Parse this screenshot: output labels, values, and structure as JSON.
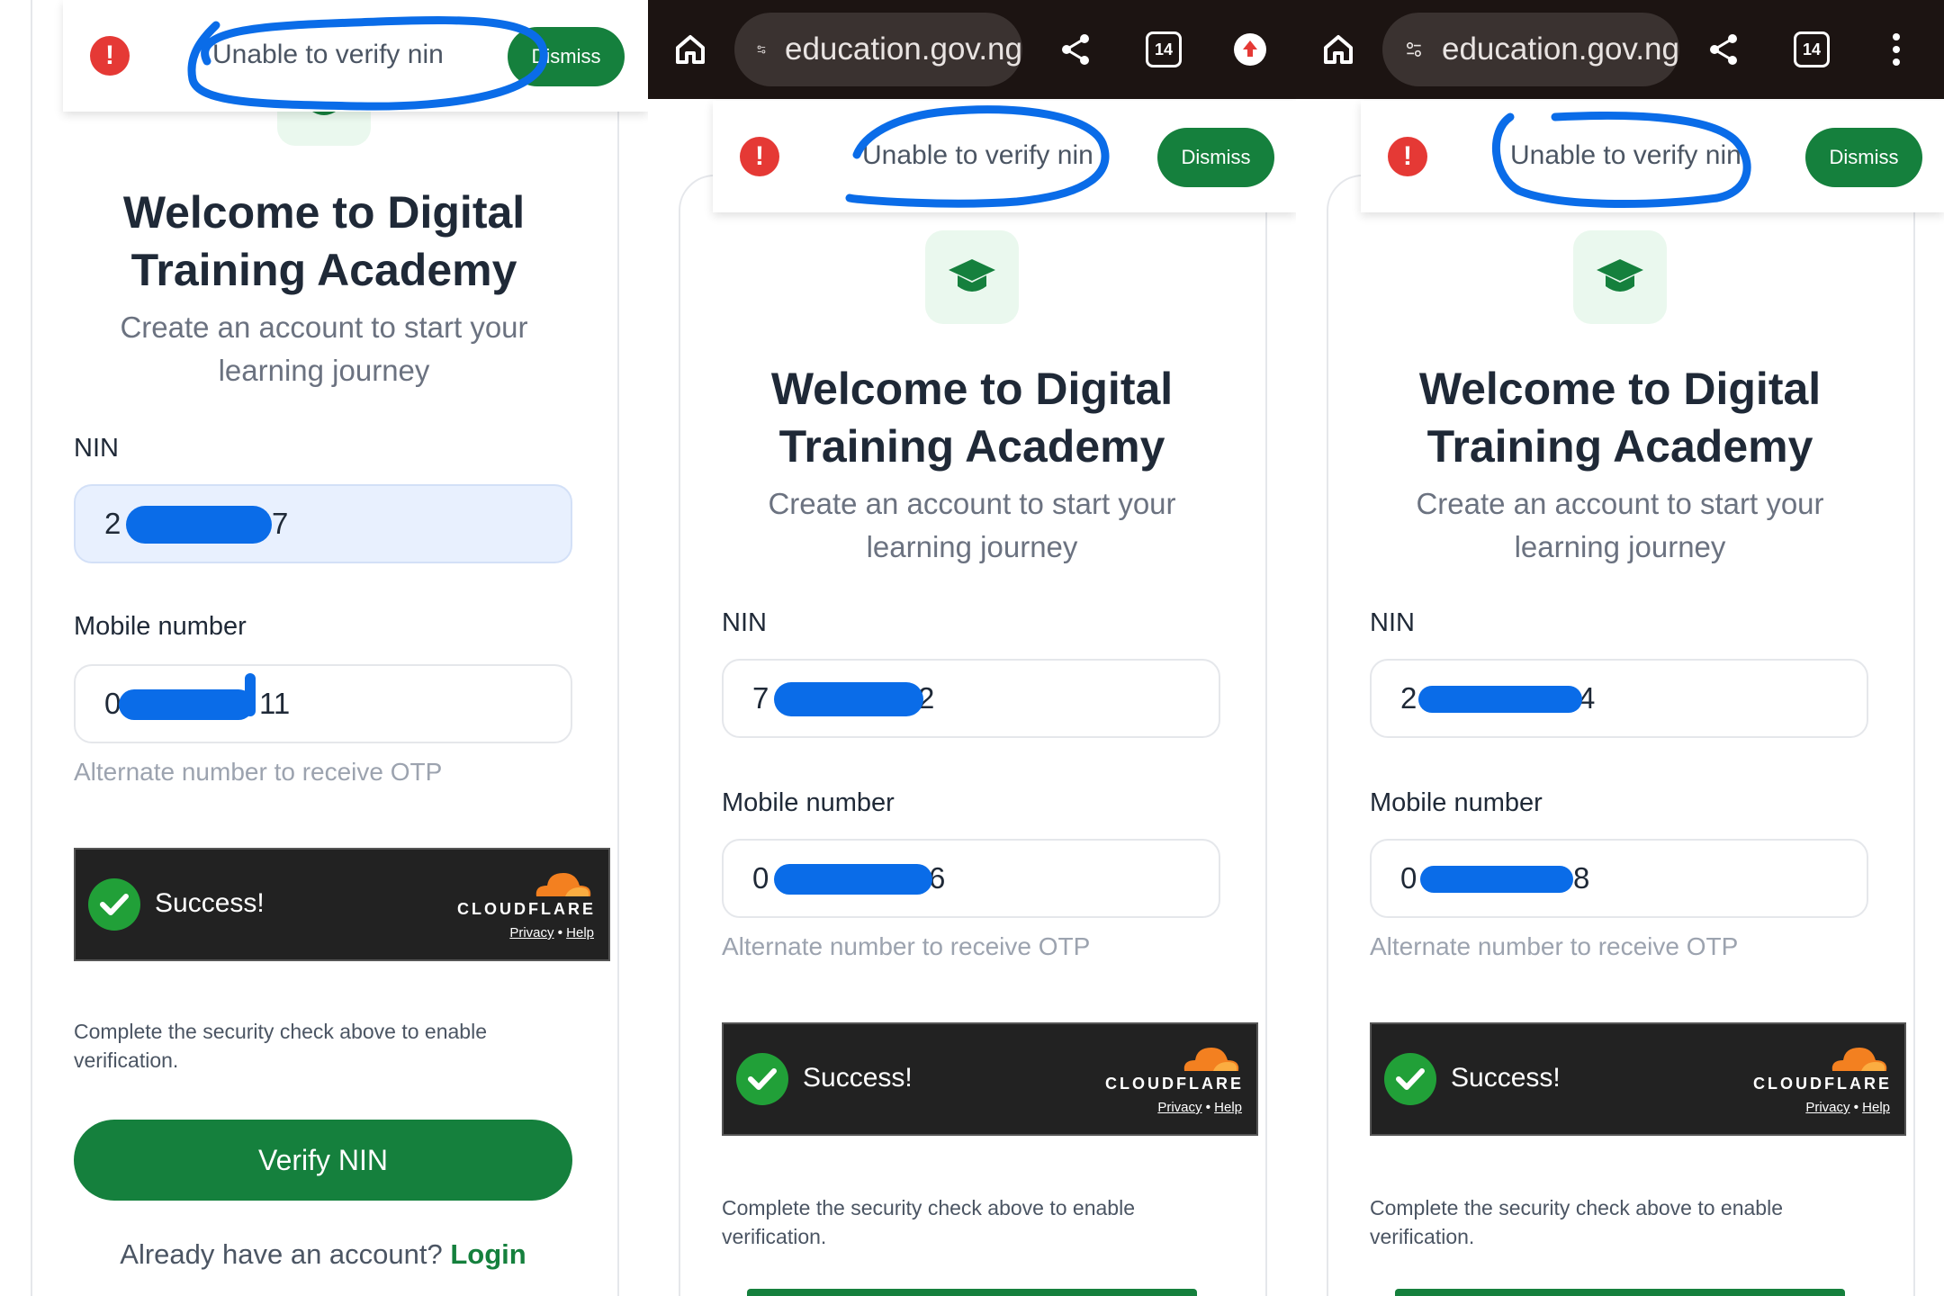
{
  "browser": {
    "url": "education.gov.ng",
    "tab_count": "14"
  },
  "toast": {
    "message": "Unable to verify nin",
    "dismiss_label": "Dismiss"
  },
  "form": {
    "title_line1": "Welcome to Digital",
    "title_line2": "Training Academy",
    "subtitle_line1": "Create an account to start your",
    "subtitle_line2": "learning journey",
    "nin_label": "NIN",
    "mobile_label": "Mobile number",
    "otp_hint": "Alternate number to receive OTP",
    "security_text": "Complete the security check above to enable verification.",
    "verify_label": "Verify NIN",
    "account_prompt": "Already have an account?",
    "login_label": "Login"
  },
  "captcha": {
    "status": "Success!",
    "brand": "CLOUDFLARE",
    "privacy": "Privacy",
    "separator": "•",
    "help": "Help"
  },
  "panels": [
    {
      "nin_start": "2",
      "nin_end": "7",
      "mobile_start": "0",
      "mobile_end": "11"
    },
    {
      "nin_start": "7",
      "nin_end": "2",
      "mobile_start": "0",
      "mobile_end": "6"
    },
    {
      "nin_start": "2",
      "nin_end": "4",
      "mobile_start": "0",
      "mobile_end": "8"
    }
  ],
  "colors": {
    "brand_green": "#15803d",
    "error_red": "#e53935",
    "annotation_blue": "#0a6ce8"
  }
}
